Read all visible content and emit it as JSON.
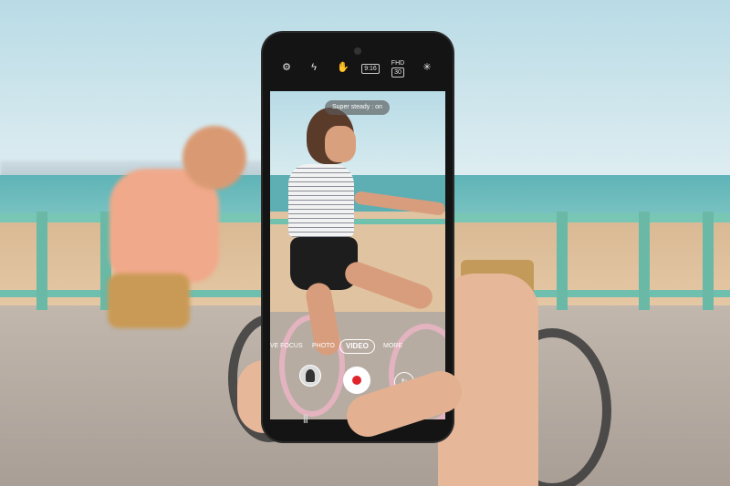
{
  "camera": {
    "toolbar": {
      "settings_icon": "gear-icon",
      "flash_icon": "flash-off-icon",
      "stabilizer_icon": "super-steady-icon",
      "ratio_label": "9:16",
      "resolution_label": "FHD",
      "resolution_sub": "30",
      "effects_icon": "sparkle-icon"
    },
    "toast": "Super steady : on",
    "modes": {
      "live_focus": "LIVE FOCUS",
      "photo": "PHOTO",
      "video": "VIDEO",
      "more": "MORE"
    },
    "gallery_icon": "gallery-thumbnail",
    "record_icon": "record-icon",
    "switch_icon": "switch-camera-icon",
    "nav_recent": "|||"
  },
  "colors": {
    "accent_active": "#f1c40f",
    "record_red": "#e0242c"
  }
}
